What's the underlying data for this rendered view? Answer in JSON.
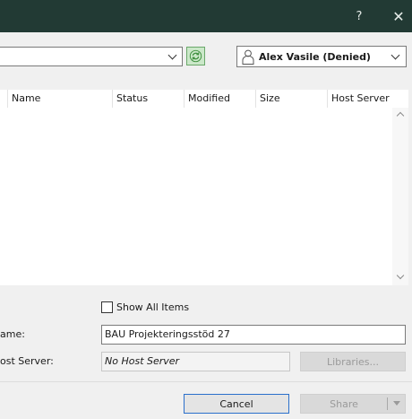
{
  "titlebar": {
    "help_label": "?",
    "close_label": "✕"
  },
  "toolbar": {
    "location_value": "",
    "user_label": "Alex Vasile (Denied)"
  },
  "list": {
    "columns": [
      "Name",
      "Status",
      "Modified",
      "Size",
      "Host Server"
    ],
    "rows": []
  },
  "options": {
    "show_all_items_label": "Show All Items",
    "show_all_items_checked": false
  },
  "fields": {
    "name_label": "ame:",
    "name_value": "BAU Projekteringsstöd 27",
    "host_server_label": "ost Server:",
    "host_server_value": "No Host Server",
    "libraries_label": "Libraries..."
  },
  "footer": {
    "cancel_label": "Cancel",
    "share_label": "Share"
  },
  "colors": {
    "titlebar": "#223a34",
    "focus_border": "#2a6fcb",
    "refresh": "#cbe8c9",
    "disabled_text": "#9a9a9a"
  },
  "icons": {
    "refresh": "refresh-icon",
    "user": "user-icon",
    "dropdown": "chevron-down-icon"
  }
}
